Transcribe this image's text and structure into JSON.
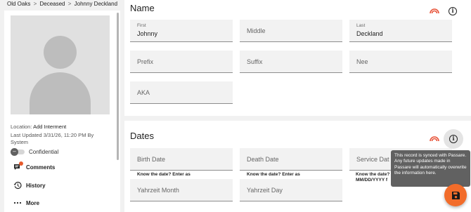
{
  "breadcrumb": {
    "items": [
      "Old Oaks",
      "Deceased",
      "Johnny Deckland"
    ],
    "separator": ">"
  },
  "profile": {
    "location_label": "Location:",
    "location_value": "Add Interment",
    "last_updated": "Last Updated 3/31/26, 11:20 PM By System",
    "confidential_label": "Confidential"
  },
  "nav": {
    "comments": "Comments",
    "history": "History",
    "more": "More"
  },
  "name_section": {
    "title": "Name",
    "first_label": "First",
    "first_value": "Johnny",
    "middle_placeholder": "Middle",
    "last_label": "Last",
    "last_value": "Deckland",
    "prefix_placeholder": "Prefix",
    "suffix_placeholder": "Suffix",
    "nee_placeholder": "Nee",
    "aka_placeholder": "AKA"
  },
  "dates_section": {
    "title": "Dates",
    "birth_date_placeholder": "Birth Date",
    "death_date_placeholder": "Death Date",
    "service_date_placeholder": "Service Dat",
    "hint_know_date": "Know the date? Enter as",
    "hint_know_date_short": "Know the date?",
    "hint_format": "MM/DD/YYYY f",
    "yahrzeit_month_placeholder": "Yahrzeit Month",
    "yahrzeit_day_placeholder": "Yahrzeit Day"
  },
  "tooltip": {
    "text": "This record is synced with Passare. Any future updates made in Passare will automatically overwrite the information here."
  },
  "icons": {
    "sync": "passare-sync-icon",
    "info": "info-icon",
    "save": "save-icon"
  },
  "colors": {
    "accent": "#f26c2a",
    "sync_icon": "#e8543a",
    "tooltip_bg": "#616161",
    "badge": "#e65a2c"
  }
}
